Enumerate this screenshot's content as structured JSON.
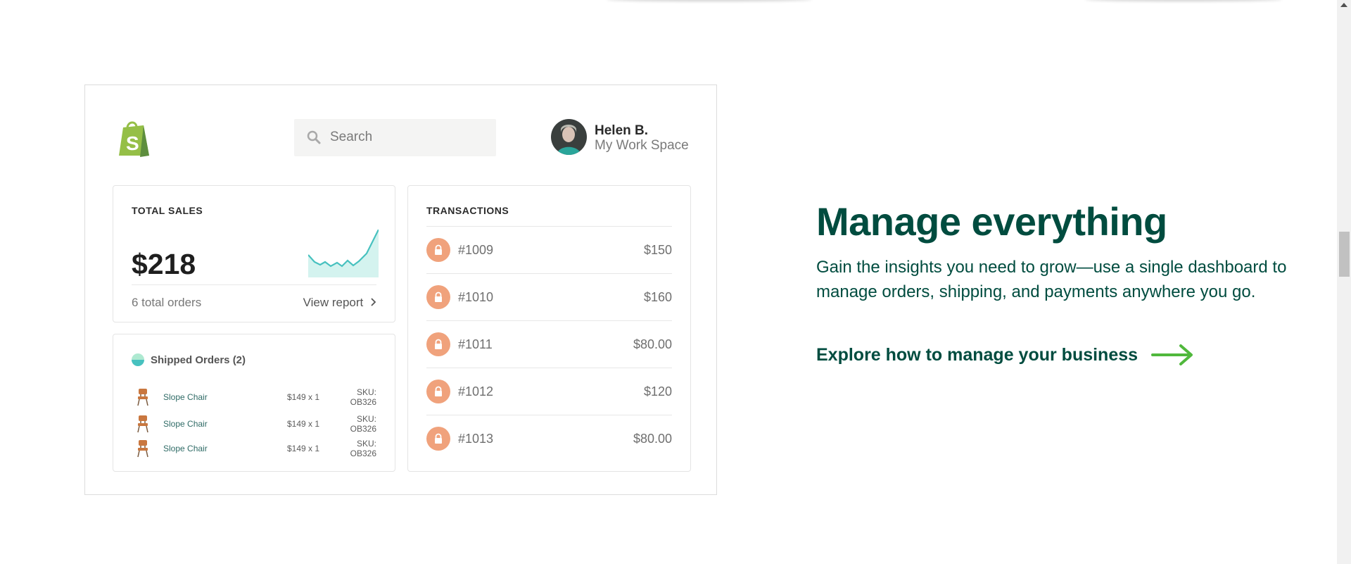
{
  "dashboard": {
    "search": {
      "placeholder": "Search"
    },
    "user": {
      "name": "Helen B.",
      "workspace": "My Work Space"
    },
    "total_sales": {
      "title": "TOTAL SALES",
      "amount": "$218",
      "orders": "6 total orders",
      "report_link": "View report"
    },
    "shipped": {
      "title": "Shipped Orders (2)",
      "items": [
        {
          "name": "Slope Chair",
          "price": "$149 x 1",
          "sku": "SKU: OB326"
        },
        {
          "name": "Slope Chair",
          "price": "$149 x 1",
          "sku": "SKU: OB326"
        },
        {
          "name": "Slope Chair",
          "price": "$149 x 1",
          "sku": "SKU: OB326"
        }
      ]
    },
    "transactions": {
      "title": "TRANSACTIONS",
      "rows": [
        {
          "id": "#1009",
          "amount": "$150"
        },
        {
          "id": "#1010",
          "amount": "$160"
        },
        {
          "id": "#1011",
          "amount": "$80.00"
        },
        {
          "id": "#1012",
          "amount": "$120"
        },
        {
          "id": "#1013",
          "amount": "$80.00"
        }
      ]
    }
  },
  "section": {
    "headline": "Manage everything",
    "description": "Gain the insights you need to grow—use a single dashboard to manage orders, shipping, and payments anywhere you go.",
    "cta": "Explore how to manage your business"
  },
  "colors": {
    "brand_dark_green": "#004c3f",
    "accent_green": "#50b83c",
    "shopify_green": "#95bf47",
    "lock_orange": "#f0a27c",
    "sparkline_teal": "#47c1bf"
  },
  "icons": {
    "logo": "shopify-bag-icon",
    "search": "search-icon",
    "lock": "lock-icon",
    "chair": "chair-icon",
    "arrow": "arrow-right-icon",
    "chevron": "chevron-right-icon"
  }
}
